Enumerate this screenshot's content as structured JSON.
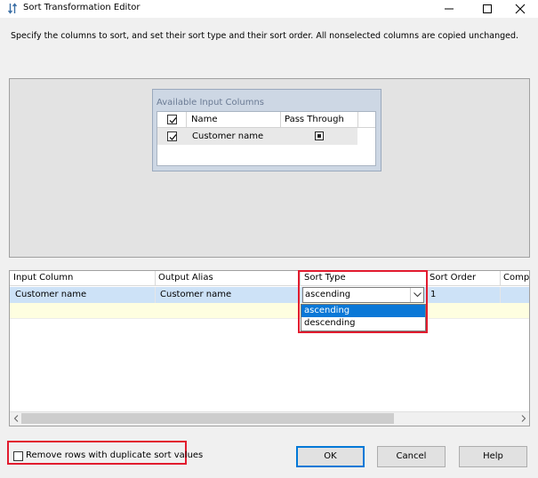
{
  "window": {
    "title": "Sort Transformation Editor"
  },
  "description": "Specify the columns to sort, and set their sort type and their sort order. All nonselected columns are copied unchanged.",
  "available_columns": {
    "title": "Available Input Columns",
    "headers": {
      "name": "Name",
      "pass_through": "Pass Through"
    },
    "rows": [
      {
        "name": "Customer name",
        "selected": true,
        "pass_through": "indeterminate"
      }
    ]
  },
  "grid": {
    "headers": [
      "Input Column",
      "Output Alias",
      "Sort Type",
      "Sort Order",
      "Compa"
    ],
    "row": {
      "input_column": "Customer name",
      "output_alias": "Customer name",
      "sort_type": "ascending",
      "sort_order": "1"
    },
    "sort_type_options": [
      "ascending",
      "descending"
    ]
  },
  "options": {
    "remove_duplicates_label": "Remove rows with duplicate sort values",
    "remove_duplicates_checked": false
  },
  "buttons": {
    "ok": "OK",
    "cancel": "Cancel",
    "help": "Help"
  },
  "colors": {
    "highlight": "#e21b2e",
    "selection": "#0a78d7",
    "row_selected": "#cde2f7",
    "row_new": "#fefee0"
  }
}
